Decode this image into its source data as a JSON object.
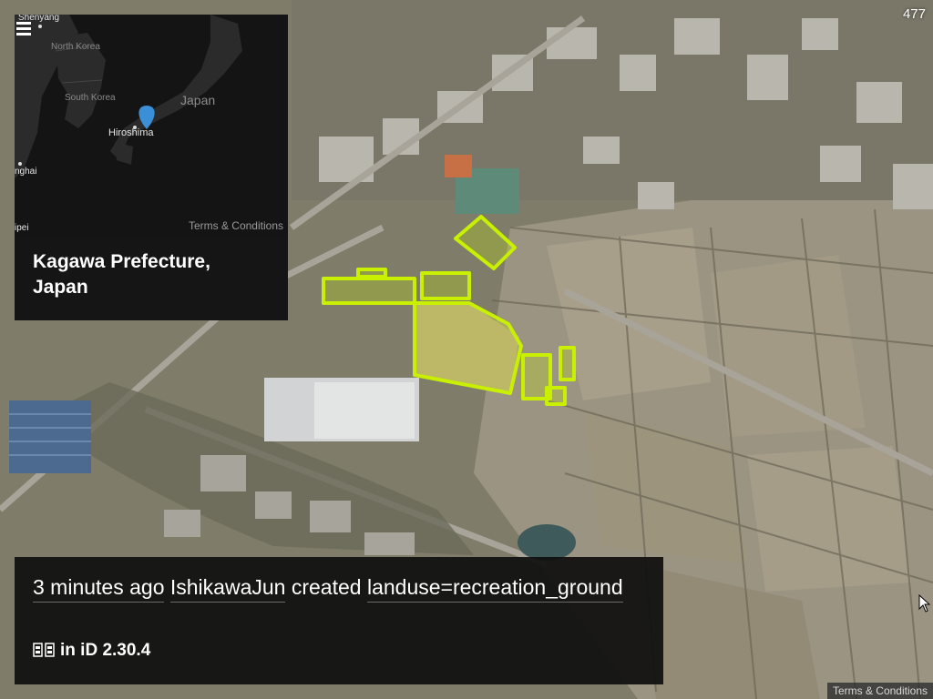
{
  "counter": "477",
  "terms_main": "Terms & Conditions",
  "inset": {
    "labels": {
      "shenyang": "Shenyang",
      "north_korea": "North Korea",
      "south_korea": "South Korea",
      "japan": "Japan",
      "hiroshima": "Hiroshima",
      "shanghai": "nghai",
      "taipei": "ipei"
    },
    "terms": "Terms & Conditions",
    "location_line1": "Kagawa Prefecture,",
    "location_line2": "Japan",
    "marker_color": "#3a8fd6"
  },
  "change": {
    "time": "3 minutes ago",
    "user": "IshikawaJun",
    "action": "created",
    "tag": "landuse=recreation_ground",
    "editor": "in iD 2.30.4"
  },
  "colors": {
    "highlight": "#c8f000",
    "panel": "#121212"
  }
}
